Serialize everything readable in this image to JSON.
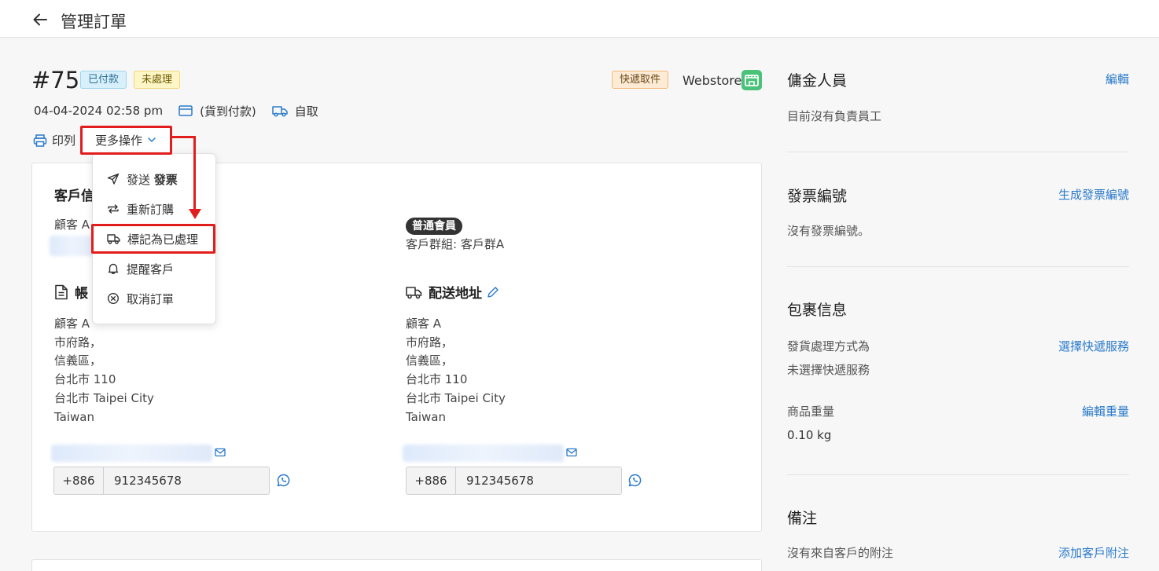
{
  "header": {
    "title": "管理訂單"
  },
  "order": {
    "number": "#75",
    "badge_paid": "已付款",
    "badge_pending": "未處理",
    "badge_delivery": "快遞取件",
    "store": "Webstore",
    "datetime": "04-04-2024 02:58 pm",
    "payment": "(貨到付款)",
    "delivery": "自取"
  },
  "actions": {
    "print": "印列",
    "more": "更多操作"
  },
  "menu": {
    "send_prefix": "發送 ",
    "send_bold": "發票",
    "reorder": "重新訂購",
    "mark_processed": "標記為已處理",
    "remind": "提醒客戶",
    "cancel": "取消訂單"
  },
  "customer": {
    "title_visible": "客戶信",
    "name_visible": "顧客 A",
    "member_badge": "普通會員",
    "group": "客戶群組: 客戶群A"
  },
  "billing": {
    "title_visible": "帳",
    "lines": [
      "顧客 A",
      "市府路，",
      "信義區，",
      "台北市 110",
      "台北市 Taipei City",
      "Taiwan"
    ],
    "phone_code": "+886",
    "phone_number": "912345678"
  },
  "shipping": {
    "title": "配送地址",
    "lines": [
      "顧客 A",
      "市府路，",
      "信義區，",
      "台北市 110",
      "台北市 Taipei City",
      "Taiwan"
    ],
    "phone_code": "+886",
    "phone_number": "912345678"
  },
  "sidebar": {
    "commission": {
      "title": "傭金人員",
      "link": "編輯",
      "text": "目前沒有負責員工"
    },
    "invoice": {
      "title": "發票編號",
      "link": "生成發票編號",
      "text": "沒有發票編號。"
    },
    "package": {
      "title": "包裹信息",
      "method_label": "發貨處理方式為",
      "method_link": "選擇快遞服務",
      "method_value": "未選擇快遞服務",
      "weight_label": "商品重量",
      "weight_link": "編輯重量",
      "weight_value": "0.10 kg"
    },
    "notes": {
      "title": "備注",
      "text": "沒有來自客戶的附注",
      "link": "添加客戶附注"
    }
  },
  "colors": {
    "link": "#2a7ac9",
    "highlight": "#e11d1d",
    "whatsapp": "#2a7ac9"
  }
}
